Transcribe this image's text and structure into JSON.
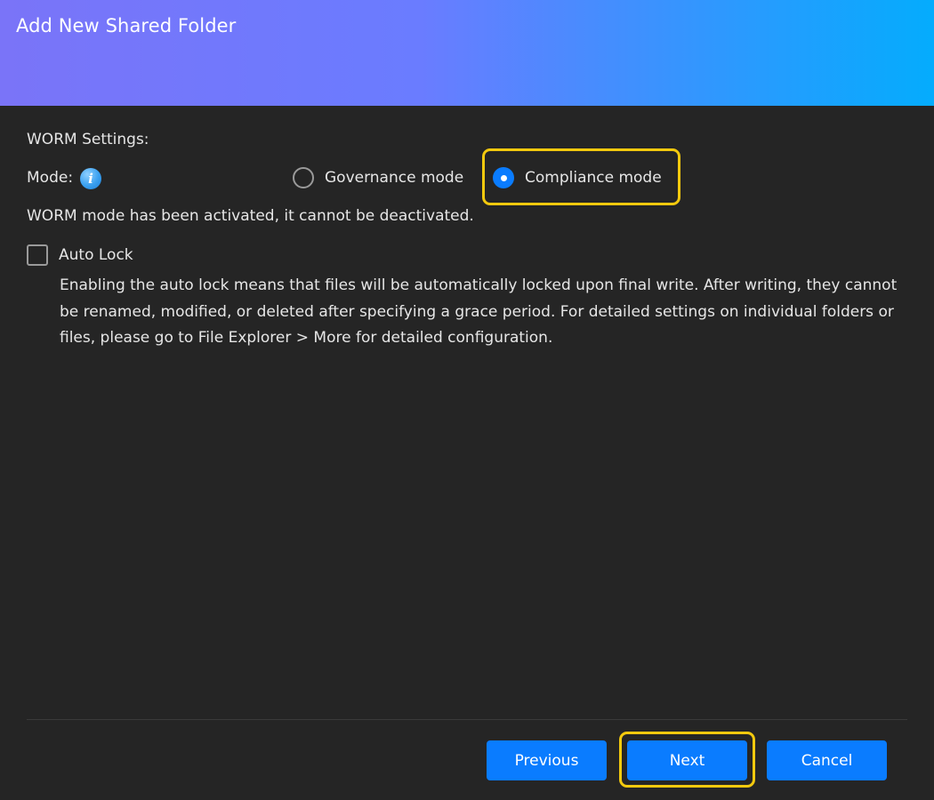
{
  "dialog": {
    "title": "Add New Shared Folder"
  },
  "worm": {
    "section_label": "WORM Settings:",
    "mode_label": "Mode:",
    "info_icon": "info-icon",
    "options": [
      {
        "label": "Governance mode",
        "selected": false
      },
      {
        "label": "Compliance mode",
        "selected": true
      }
    ],
    "note": "WORM mode has been activated, it cannot be deactivated."
  },
  "auto_lock": {
    "label": "Auto Lock",
    "checked": false,
    "description": "Enabling the auto lock means that files will be automatically locked upon final write. After writing, they cannot be renamed, modified, or deleted after specifying a grace period. For detailed settings on individual folders or files, please go to File Explorer > More for detailed configuration."
  },
  "footer": {
    "previous_label": "Previous",
    "next_label": "Next",
    "cancel_label": "Cancel"
  },
  "colors": {
    "accent": "#0a7cff",
    "highlight": "#f3c90e",
    "background": "#252525",
    "header_gradient_start": "#7a74f8",
    "header_gradient_end": "#04acfd"
  }
}
